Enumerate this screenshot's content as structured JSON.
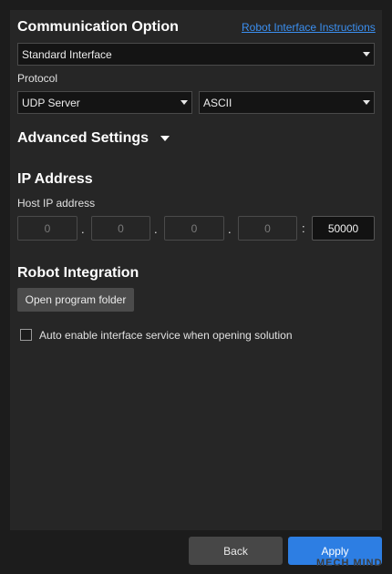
{
  "communication": {
    "title": "Communication Option",
    "instructions_link": "Robot Interface Instructions",
    "interface_selected": "Standard Interface"
  },
  "protocol": {
    "label": "Protocol",
    "transport_selected": "UDP Server",
    "format_selected": "ASCII"
  },
  "advanced": {
    "title": "Advanced Settings"
  },
  "ip": {
    "title": "IP Address",
    "host_label": "Host IP address",
    "octets": [
      "0",
      "0",
      "0",
      "0"
    ],
    "dot": ".",
    "colon": ":",
    "port": "50000"
  },
  "robot_integration": {
    "title": "Robot Integration",
    "open_folder_label": "Open program folder",
    "auto_enable_label": "Auto enable interface service when opening solution"
  },
  "footer": {
    "back_label": "Back",
    "apply_label": "Apply",
    "watermark": "MECH MIND"
  },
  "colors": {
    "accent": "#2d7ee3",
    "link": "#3b8ff0",
    "panel": "#262626",
    "background": "#1c1c1c"
  }
}
